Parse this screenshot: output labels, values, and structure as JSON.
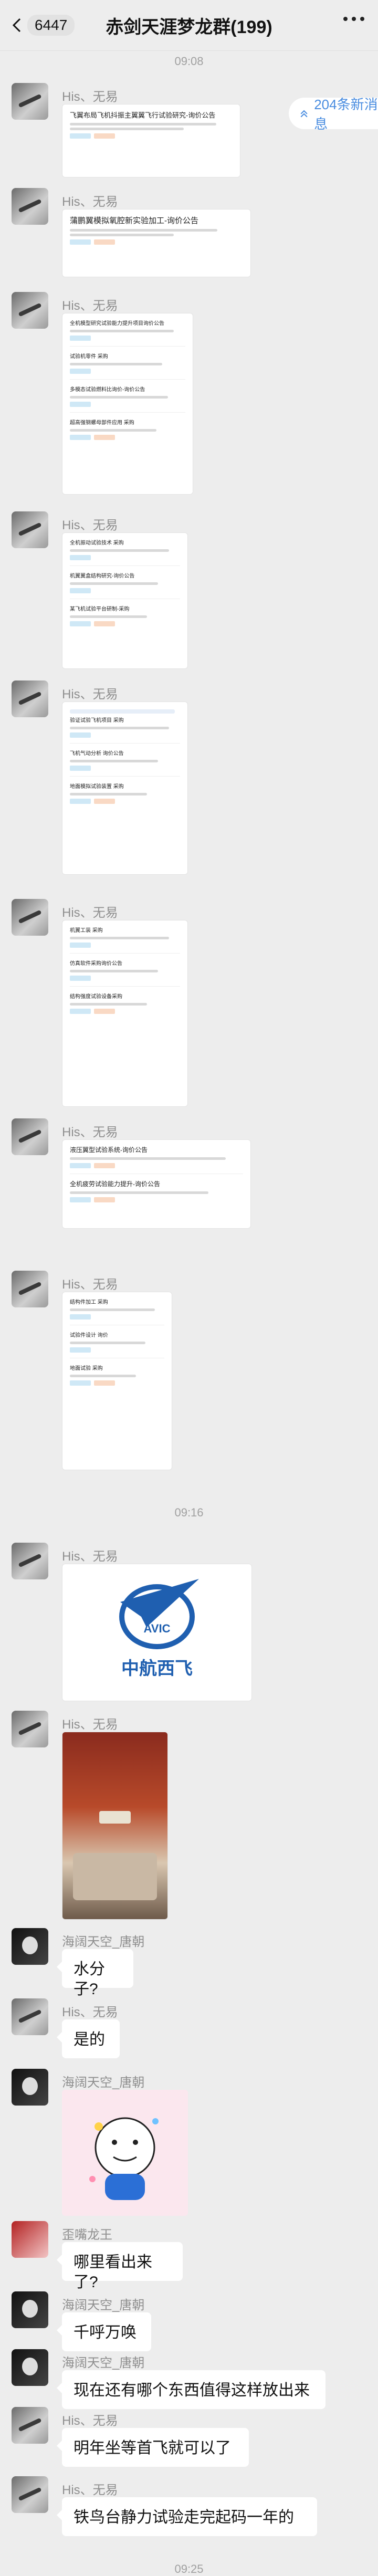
{
  "header": {
    "unread_count": "6447",
    "title": "赤剑天涯梦龙群(199)"
  },
  "new_messages_badge": "204条新消息",
  "timestamps": [
    "09:08",
    "09:16",
    "09:25"
  ],
  "messages": [
    {
      "sender": "His、无易",
      "doc_titles": [
        "飞翼布局飞机抖振主翼翼飞行试验研究-询价公告"
      ]
    },
    {
      "sender": "His、无易",
      "doc_titles": [
        "蒲鹏翼模拟氧腔新实验加工-询价公告"
      ]
    },
    {
      "sender": "His、无易",
      "doc_titles": [
        "全机模型研究试验能力提升项目询价公告",
        "试验机零件 采购",
        "多模态试验燃料比询价-询价公告",
        "超高强钢螺母部件应用 采购"
      ]
    },
    {
      "sender": "His、无易",
      "doc_titles": [
        "全机振动试验技术 采购",
        "机翼翼盒结构研究-询价公告",
        "某飞机试验平台研制-采购"
      ]
    },
    {
      "sender": "His、无易",
      "doc_titles": [
        "验证试验飞机项目 采购",
        "飞机气动分析 询价公告",
        "地面模拟试验装置 采购"
      ]
    },
    {
      "sender": "His、无易",
      "doc_titles": [
        "机翼工装 采购",
        "仿真软件采购询价公告",
        "结构强度试验设备采购"
      ]
    },
    {
      "sender": "His、无易",
      "doc_titles": [
        "液压翼型试验系统-询价公告",
        "全机疲劳试验能力提升-询价公告"
      ]
    },
    {
      "sender": "His、无易",
      "doc_titles": [
        "结构件加工 采购",
        "试验件设计 询价",
        "地面试验 采购"
      ]
    },
    {
      "sender": "His、无易",
      "image": "中航西飞 AVIC logo"
    },
    {
      "sender": "His、无易",
      "image": "photo"
    },
    {
      "sender": "海阔天空_唐朝",
      "text": "水分子?"
    },
    {
      "sender": "His、无易",
      "text": "是的"
    },
    {
      "sender": "海阔天空_唐朝",
      "image": "sticker"
    },
    {
      "sender": "歪嘴龙王",
      "text": "哪里看出来了?"
    },
    {
      "sender": "海阔天空_唐朝",
      "text": "千呼万唤"
    },
    {
      "sender": "海阔天空_唐朝",
      "text": "现在还有哪个东西值得这样放出来"
    },
    {
      "sender": "His、无易",
      "text": "明年坐等首飞就可以了"
    },
    {
      "sender": "His、无易",
      "text": "铁鸟台静力试验走完起码一年的"
    }
  ],
  "logo": {
    "brand_text": "中航西飞",
    "mark_text": "AVIC"
  },
  "colors": {
    "accent_blue": "#4a8de0",
    "background": "#ededed",
    "bubble": "#ffffff"
  },
  "icons": [
    "back-chevron-icon",
    "more-dots-icon",
    "double-chevron-up-icon"
  ]
}
